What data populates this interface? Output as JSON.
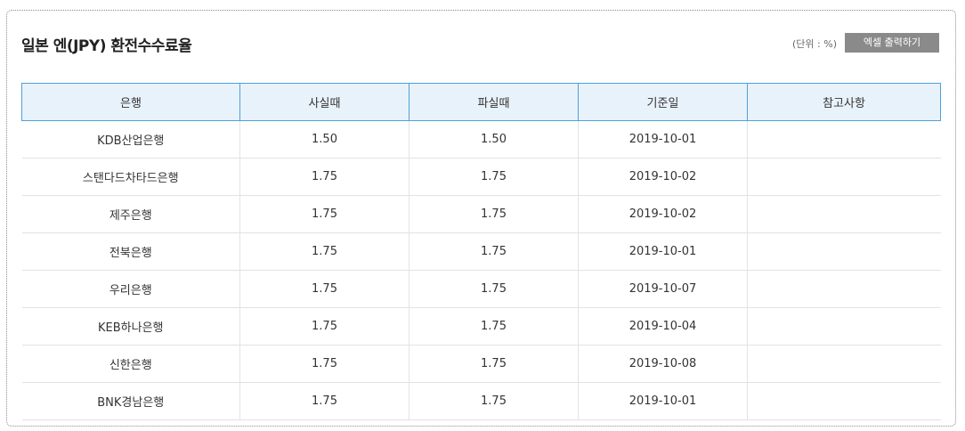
{
  "header": {
    "title": "일본 엔(JPY) 환전수수료율",
    "unit_note": "(단위 : %)",
    "excel_label": "엑셀 출력하기"
  },
  "table": {
    "columns": [
      "은행",
      "사실때",
      "파실때",
      "기준일",
      "참고사항"
    ],
    "rows": [
      {
        "bank": "KDB산업은행",
        "buy": "1.50",
        "sell": "1.50",
        "date": "2019-10-01",
        "note": ""
      },
      {
        "bank": "스탠다드차타드은행",
        "buy": "1.75",
        "sell": "1.75",
        "date": "2019-10-02",
        "note": ""
      },
      {
        "bank": "제주은행",
        "buy": "1.75",
        "sell": "1.75",
        "date": "2019-10-02",
        "note": ""
      },
      {
        "bank": "전북은행",
        "buy": "1.75",
        "sell": "1.75",
        "date": "2019-10-01",
        "note": ""
      },
      {
        "bank": "우리은행",
        "buy": "1.75",
        "sell": "1.75",
        "date": "2019-10-07",
        "note": ""
      },
      {
        "bank": "KEB하나은행",
        "buy": "1.75",
        "sell": "1.75",
        "date": "2019-10-04",
        "note": ""
      },
      {
        "bank": "신한은행",
        "buy": "1.75",
        "sell": "1.75",
        "date": "2019-10-08",
        "note": ""
      },
      {
        "bank": "BNK경남은행",
        "buy": "1.75",
        "sell": "1.75",
        "date": "2019-10-01",
        "note": ""
      }
    ]
  },
  "colors": {
    "header_bg": "#e8f2fb",
    "header_border": "#4fa0d8",
    "button_bg": "#8a8a8a"
  }
}
